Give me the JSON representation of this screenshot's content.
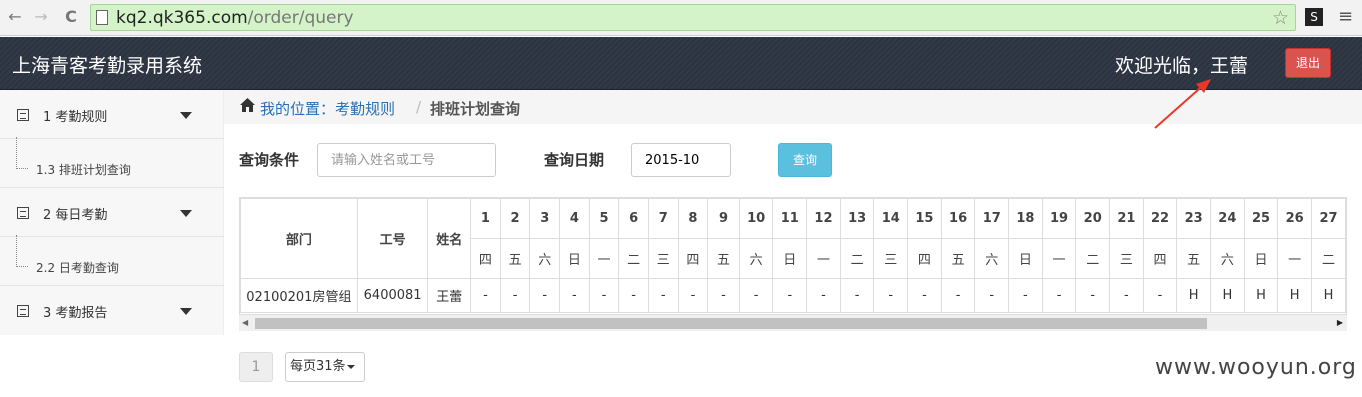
{
  "browser": {
    "url_domain": "kq2.qk365.com",
    "url_path": "/order/query",
    "ext_label": "S",
    "back_glyph": "←",
    "forward_glyph": "→",
    "reload_glyph": "C",
    "star_glyph": "☆",
    "menu_glyph": "≡"
  },
  "header": {
    "brand": "上海青客考勤录用系统",
    "welcome": "欢迎光临，王蕾",
    "logout": "退出"
  },
  "sidebar": {
    "groups": [
      {
        "label": "1 考勤规则",
        "sub": "1.3 排班计划查询"
      },
      {
        "label": "2 每日考勤",
        "sub": "2.2 日考勤查询"
      },
      {
        "label": "3 考勤报告"
      }
    ]
  },
  "breadcrumb": {
    "location": "我的位置：考勤规则",
    "separator": "/",
    "current": "排班计划查询"
  },
  "filter": {
    "cond_label": "查询条件",
    "cond_placeholder": "请输入姓名或工号",
    "date_label": "查询日期",
    "date_value": "2015-10",
    "query_button": "查询"
  },
  "table": {
    "headers": [
      "部门",
      "工号",
      "姓名"
    ],
    "days": [
      "1",
      "2",
      "3",
      "4",
      "5",
      "6",
      "7",
      "8",
      "9",
      "10",
      "11",
      "12",
      "13",
      "14",
      "15",
      "16",
      "17",
      "18",
      "19",
      "20",
      "21",
      "22",
      "23",
      "24",
      "25",
      "26",
      "27"
    ],
    "weekdays": [
      "四",
      "五",
      "六",
      "日",
      "一",
      "二",
      "三",
      "四",
      "五",
      "六",
      "日",
      "一",
      "二",
      "三",
      "四",
      "五",
      "六",
      "日",
      "一",
      "二",
      "三",
      "四",
      "五",
      "六",
      "日",
      "一",
      "二"
    ],
    "row": {
      "dept": "02100201房管组",
      "id": "6400081",
      "name": "王蕾",
      "cells": [
        "-",
        "-",
        "-",
        "-",
        "-",
        "-",
        "-",
        "-",
        "-",
        "-",
        "-",
        "-",
        "-",
        "-",
        "-",
        "-",
        "-",
        "-",
        "-",
        "-",
        "-",
        "-",
        "H",
        "H",
        "H",
        "H",
        "H"
      ]
    }
  },
  "pagination": {
    "page": "1",
    "per_page": "每页31条"
  },
  "watermark": "www.wooyun.org",
  "colors": {
    "topbar": "#2f3744",
    "logout": "#d9534f",
    "query": "#5bc0de",
    "link": "#2a6fb5",
    "annotation_arrow": "#e8382a"
  }
}
